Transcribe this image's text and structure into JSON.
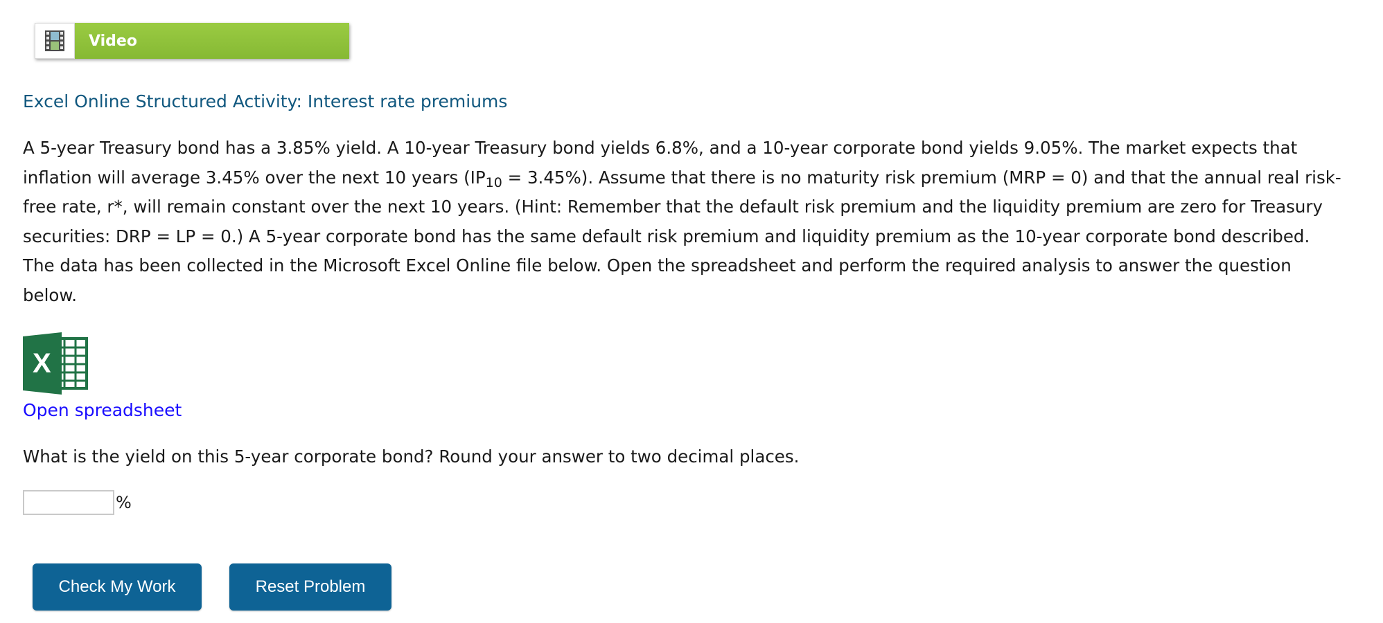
{
  "video": {
    "label": "Video",
    "icon": "film-icon"
  },
  "activity": {
    "title": "Excel Online Structured Activity: Interest rate premiums"
  },
  "problem": {
    "text_before_sub": "A 5-year Treasury bond has a 3.85% yield. A 10-year Treasury bond yields 6.8%, and a 10-year corporate bond yields 9.05%. The market expects that inflation will average 3.45% over the next 10 years (IP",
    "subscript": "10",
    "text_after_sub": " = 3.45%). Assume that there is no maturity risk premium (MRP = 0) and that the annual real risk-free rate, r*, will remain constant over the next 10 years. (Hint: Remember that the default risk premium and the liquidity premium are zero for Treasury securities: DRP = LP = 0.) A 5-year corporate bond has the same default risk premium and liquidity premium as the 10-year corporate bond described. The data has been collected in the Microsoft Excel Online file below. Open the spreadsheet and perform the required analysis to answer the question below."
  },
  "spreadsheet": {
    "icon": "excel-icon",
    "icon_letter": "X",
    "link_label": "Open spreadsheet",
    "brand_color": "#217346"
  },
  "question": {
    "text": "What is the yield on this 5-year corporate bond? Round your answer to two decimal places."
  },
  "answer": {
    "value": "",
    "placeholder": "",
    "unit": "%"
  },
  "buttons": {
    "check_label": "Check My Work",
    "reset_label": "Reset Problem",
    "color": "#0e6395"
  }
}
